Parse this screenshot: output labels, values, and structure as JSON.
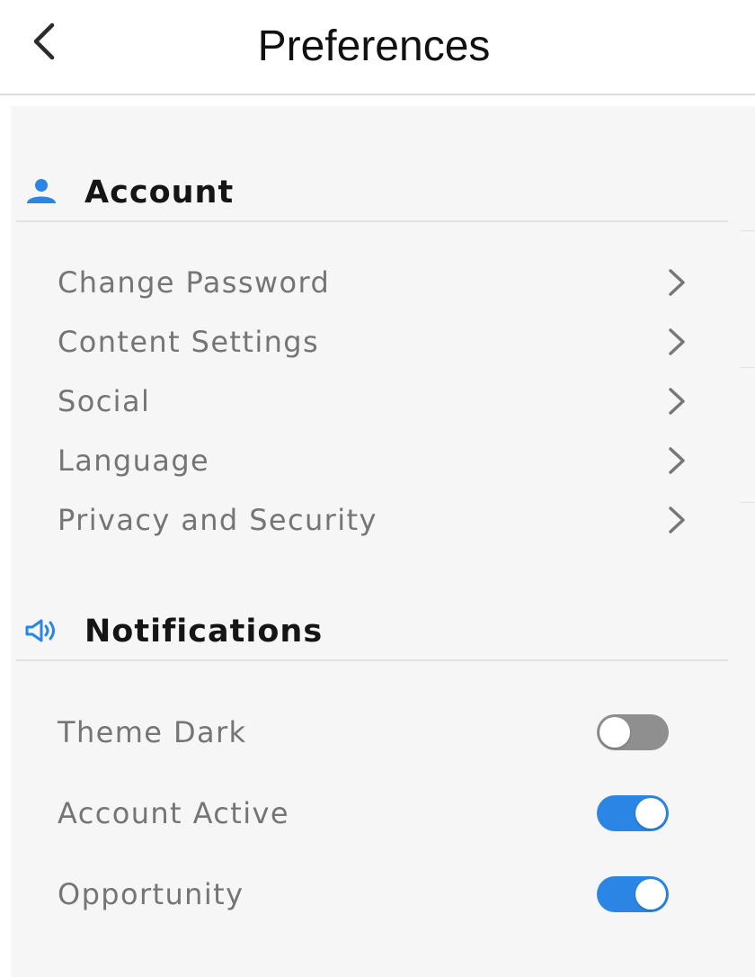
{
  "header": {
    "title": "Preferences",
    "back_icon": "chevron-left-icon"
  },
  "colors": {
    "accent": "#2a85e4",
    "toggle_off": "#8f8f8f",
    "label_text": "#757575",
    "section_text": "#151515",
    "panel_bg": "#f6f6f6"
  },
  "account": {
    "title": "Account",
    "icon": "user-icon",
    "items": [
      {
        "label": "Change Password",
        "icon": "chevron-right-icon"
      },
      {
        "label": "Content Settings",
        "icon": "chevron-right-icon"
      },
      {
        "label": "Social",
        "icon": "chevron-right-icon"
      },
      {
        "label": "Language",
        "icon": "chevron-right-icon"
      },
      {
        "label": "Privacy and Security",
        "icon": "chevron-right-icon"
      }
    ]
  },
  "notifications": {
    "title": "Notifications",
    "icon": "speaker-icon",
    "toggles": [
      {
        "label": "Theme Dark",
        "enabled": false
      },
      {
        "label": "Account Active",
        "enabled": true
      },
      {
        "label": "Opportunity",
        "enabled": true
      }
    ]
  }
}
